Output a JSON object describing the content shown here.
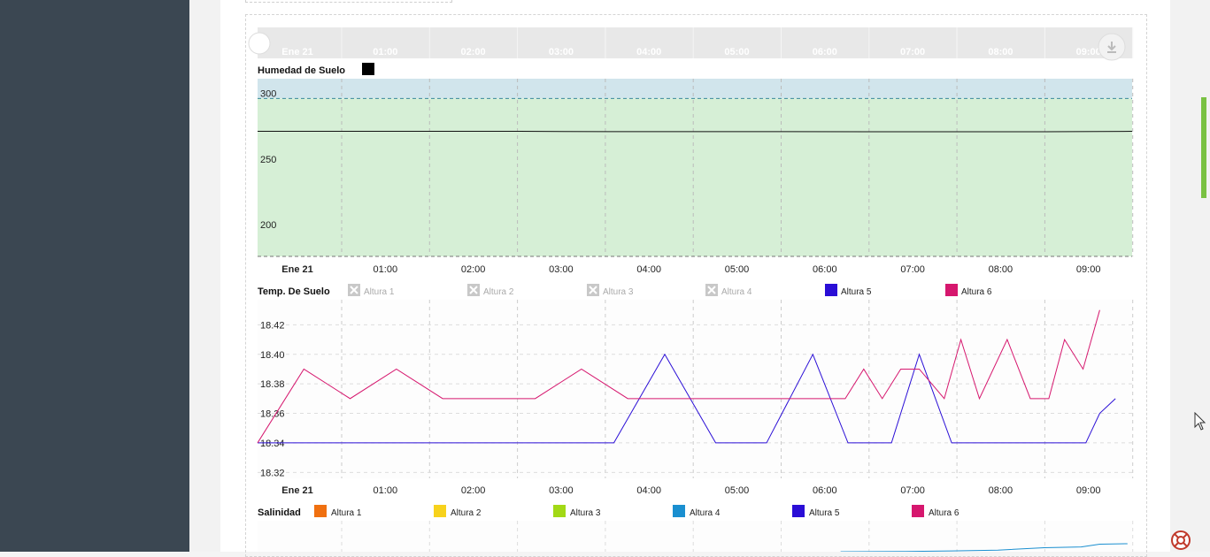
{
  "time_labels": [
    "Ene 21",
    "01:00",
    "02:00",
    "03:00",
    "04:00",
    "05:00",
    "06:00",
    "07:00",
    "08:00",
    "09:00"
  ],
  "chart_data": [
    {
      "type": "line",
      "title": "Humedad de Suelo",
      "x": [
        "Ene 21",
        "01:00",
        "02:00",
        "03:00",
        "04:00",
        "05:00",
        "06:00",
        "07:00",
        "08:00",
        "09:00"
      ],
      "ylim": [
        180,
        315
      ],
      "y_ticks": [
        "300",
        "250",
        "200"
      ],
      "bands": [
        {
          "from": 300,
          "to": 320,
          "color": "#d1e5ec"
        },
        {
          "from": 180,
          "to": 300,
          "color": "#d6efd6"
        },
        {
          "from": 160,
          "to": 180,
          "color": "#f6d6d8"
        }
      ],
      "thresholds": [
        300,
        180
      ],
      "series": [
        {
          "color": "#111111",
          "values": [
            275,
            275,
            275,
            275,
            274.8,
            274.8,
            274.8,
            274.7,
            274.7,
            274.7,
            275
          ]
        }
      ]
    },
    {
      "type": "line",
      "title": "Temp. De Suelo",
      "x": [
        "Ene 21",
        "01:00",
        "02:00",
        "03:00",
        "04:00",
        "05:00",
        "06:00",
        "07:00",
        "08:00",
        "09:00"
      ],
      "ylim": [
        18.32,
        18.43
      ],
      "y_ticks": [
        "18.42",
        "18.40",
        "18.38",
        "18.36",
        "18.34",
        "18.32"
      ],
      "legend": [
        {
          "name": "Altura 1",
          "color": "#cccccc",
          "hidden": true
        },
        {
          "name": "Altura 2",
          "color": "#cccccc",
          "hidden": true
        },
        {
          "name": "Altura 3",
          "color": "#cccccc",
          "hidden": true
        },
        {
          "name": "Altura 4",
          "color": "#cccccc",
          "hidden": true
        },
        {
          "name": "Altura 5",
          "color": "#2a0ed6",
          "hidden": false
        },
        {
          "name": "Altura 6",
          "color": "#d6176e",
          "hidden": false
        }
      ],
      "series": [
        {
          "name": "Altura 5",
          "color": "#2a0ed6",
          "points": [
            [
              0,
              18.34
            ],
            [
              1,
              18.34
            ],
            [
              2,
              18.34
            ],
            [
              3,
              18.34
            ],
            [
              3.85,
              18.34
            ],
            [
              4.4,
              18.4
            ],
            [
              4.95,
              18.34
            ],
            [
              5.5,
              18.34
            ],
            [
              6.0,
              18.4
            ],
            [
              6.38,
              18.34
            ],
            [
              6.85,
              18.34
            ],
            [
              7.15,
              18.4
            ],
            [
              7.5,
              18.34
            ],
            [
              8.0,
              18.34
            ],
            [
              8.5,
              18.34
            ],
            [
              8.95,
              18.34
            ],
            [
              9.1,
              18.36
            ],
            [
              9.27,
              18.37
            ]
          ]
        },
        {
          "name": "Altura 6",
          "color": "#d6176e",
          "points": [
            [
              0,
              18.34
            ],
            [
              0.5,
              18.39
            ],
            [
              1.0,
              18.37
            ],
            [
              1.5,
              18.39
            ],
            [
              2.0,
              18.37
            ],
            [
              2.5,
              18.37
            ],
            [
              3.0,
              18.37
            ],
            [
              3.5,
              18.39
            ],
            [
              4.0,
              18.37
            ],
            [
              4.5,
              18.37
            ],
            [
              5.0,
              18.37
            ],
            [
              5.5,
              18.37
            ],
            [
              6.0,
              18.37
            ],
            [
              6.35,
              18.37
            ],
            [
              6.55,
              18.39
            ],
            [
              6.75,
              18.37
            ],
            [
              6.95,
              18.39
            ],
            [
              7.15,
              18.39
            ],
            [
              7.42,
              18.37
            ],
            [
              7.6,
              18.41
            ],
            [
              7.8,
              18.37
            ],
            [
              8.1,
              18.41
            ],
            [
              8.35,
              18.37
            ],
            [
              8.55,
              18.37
            ],
            [
              8.72,
              18.41
            ],
            [
              8.92,
              18.39
            ],
            [
              9.1,
              18.43
            ]
          ]
        }
      ]
    },
    {
      "type": "line",
      "title": "Salinidad",
      "legend": [
        {
          "name": "Altura 1",
          "color": "#f07010",
          "hidden": false
        },
        {
          "name": "Altura 2",
          "color": "#f7d21c",
          "hidden": false
        },
        {
          "name": "Altura 3",
          "color": "#a2d916",
          "hidden": false
        },
        {
          "name": "Altura 4",
          "color": "#1a8fd0",
          "hidden": false
        },
        {
          "name": "Altura 5",
          "color": "#2a0ed6",
          "hidden": false
        },
        {
          "name": "Altura 6",
          "color": "#d6176e",
          "hidden": false
        }
      ],
      "series": [
        {
          "name": "Altura 4",
          "color": "#1a8fd0",
          "visible_trend": "rising",
          "points": [
            [
              6.3,
              0.0
            ],
            [
              7.0,
              0.03
            ],
            [
              7.5,
              0.1
            ],
            [
              8.0,
              0.2
            ],
            [
              8.5,
              0.5
            ],
            [
              8.9,
              0.6
            ],
            [
              9.1,
              0.95
            ],
            [
              9.4,
              1.0
            ]
          ]
        }
      ]
    }
  ]
}
